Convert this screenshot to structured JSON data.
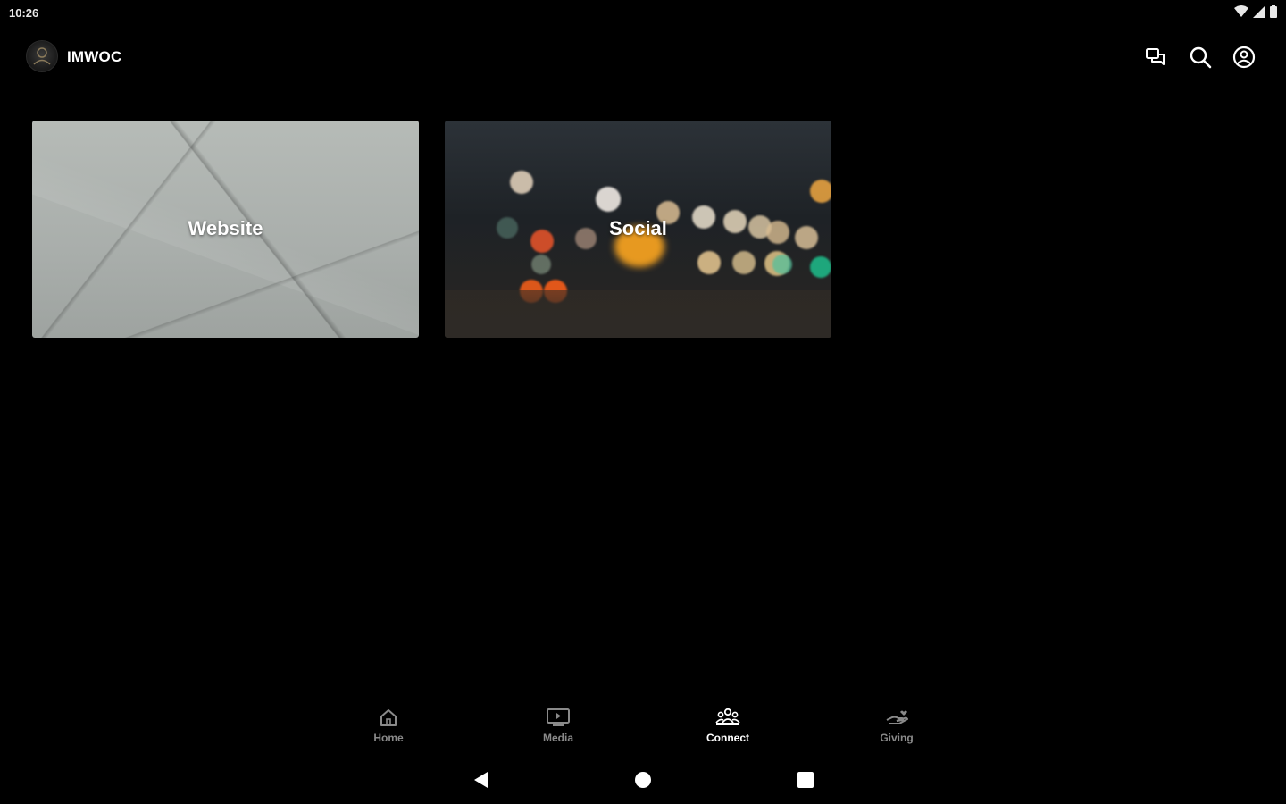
{
  "status_bar": {
    "time": "10:26",
    "icons": [
      "wifi-icon",
      "signal-icon",
      "battery-icon"
    ]
  },
  "app_bar": {
    "title": "IMWOC",
    "actions": [
      "chat-icon",
      "search-icon",
      "account-icon"
    ]
  },
  "cards": [
    {
      "label": "Website"
    },
    {
      "label": "Social"
    }
  ],
  "bottom_nav": {
    "items": [
      {
        "label": "Home",
        "icon": "home-icon",
        "active": false
      },
      {
        "label": "Media",
        "icon": "media-icon",
        "active": false
      },
      {
        "label": "Connect",
        "icon": "connect-icon",
        "active": true
      },
      {
        "label": "Giving",
        "icon": "giving-icon",
        "active": false
      }
    ]
  },
  "colors": {
    "background": "#000000",
    "active": "#ffffff",
    "inactive": "#8a8a8a"
  }
}
